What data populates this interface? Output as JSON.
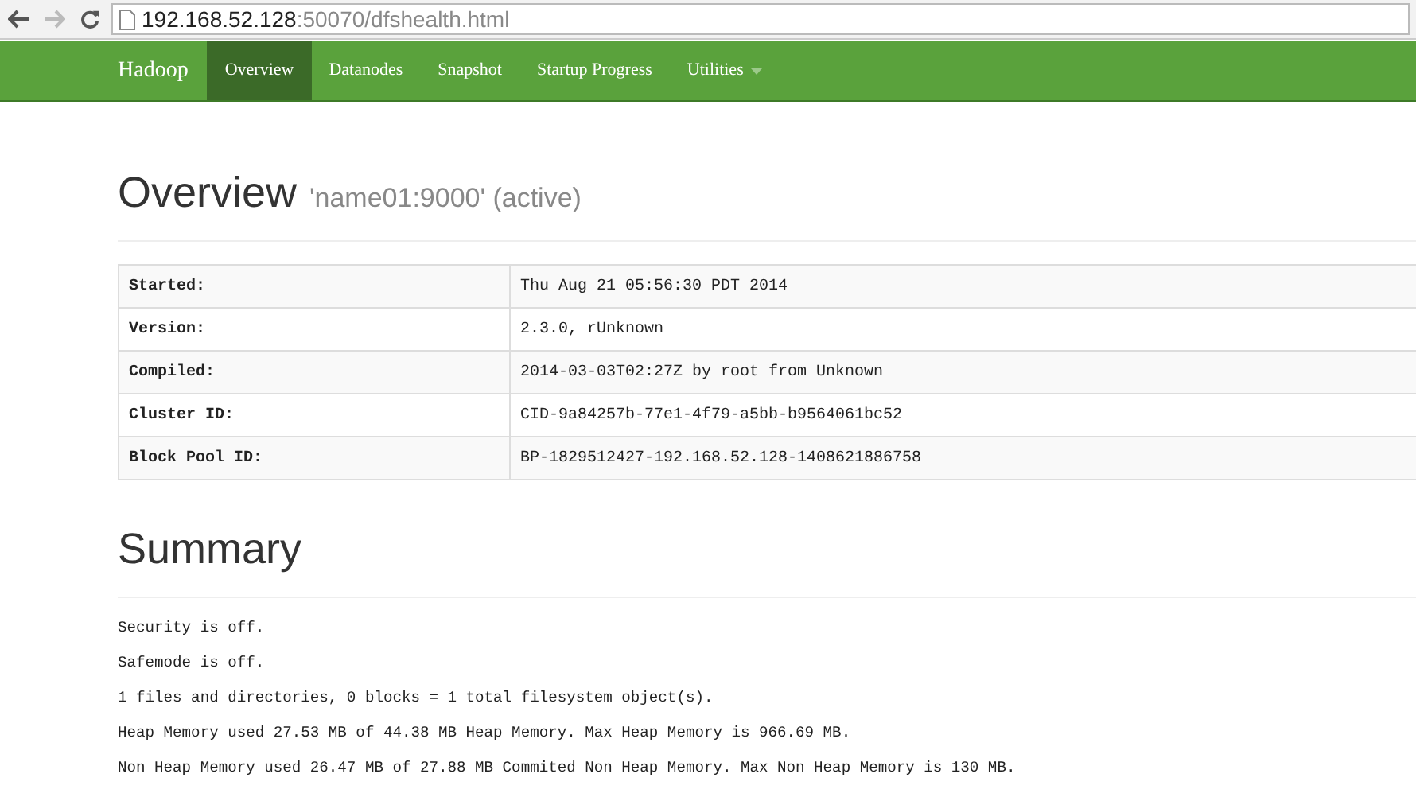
{
  "browser": {
    "back_enabled": true,
    "forward_enabled": false,
    "url_host": "192.168.52.128",
    "url_rest": ":50070/dfshealth.html"
  },
  "navbar": {
    "brand": "Hadoop",
    "items": [
      {
        "label": "Overview",
        "selected": true,
        "dropdown": false
      },
      {
        "label": "Datanodes",
        "selected": false,
        "dropdown": false
      },
      {
        "label": "Snapshot",
        "selected": false,
        "dropdown": false
      },
      {
        "label": "Startup Progress",
        "selected": false,
        "dropdown": false
      },
      {
        "label": "Utilities",
        "selected": false,
        "dropdown": true
      }
    ]
  },
  "overview": {
    "title": "Overview",
    "subtitle": "'name01:9000' (active)",
    "rows": [
      {
        "label": "Started:",
        "value": "Thu Aug 21 05:56:30 PDT 2014"
      },
      {
        "label": "Version:",
        "value": "2.3.0, rUnknown"
      },
      {
        "label": "Compiled:",
        "value": "2014-03-03T02:27Z by root from Unknown"
      },
      {
        "label": "Cluster ID:",
        "value": "CID-9a84257b-77e1-4f79-a5bb-b9564061bc52"
      },
      {
        "label": "Block Pool ID:",
        "value": "BP-1829512427-192.168.52.128-1408621886758"
      }
    ]
  },
  "summary": {
    "title": "Summary",
    "lines": [
      "Security is off.",
      "Safemode is off.",
      "1 files and directories, 0 blocks = 1 total filesystem object(s).",
      "Heap Memory used 27.53 MB of 44.38 MB Heap Memory. Max Heap Memory is 966.69 MB.",
      "Non Heap Memory used 26.47 MB of 27.88 MB Commited Non Heap Memory. Max Non Heap Memory is 130 MB."
    ]
  }
}
